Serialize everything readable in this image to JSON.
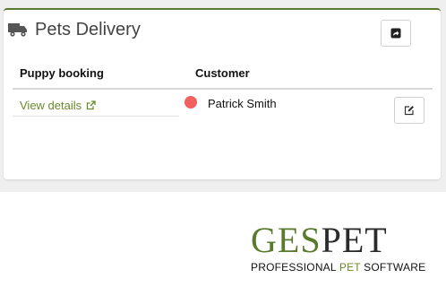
{
  "card": {
    "title": "Pets Delivery",
    "header_icon": "truck-icon",
    "share_icon": "share-icon",
    "accent": "#5a7a2e"
  },
  "table": {
    "columns": [
      "Puppy booking",
      "Customer"
    ],
    "rows": [
      {
        "booking_link": "View details",
        "booking_link_icon": "external-link-icon",
        "status_color": "#f26060",
        "customer": "Patrick Smith",
        "action_icon": "edit-icon"
      }
    ]
  },
  "brand": {
    "logo_part1": "GES",
    "logo_part2": "PET",
    "tagline_part1": "PROFESSIONAL ",
    "tagline_part2": "PET",
    "tagline_part3": " SOFTWARE",
    "accent": "#5a7a2e"
  }
}
